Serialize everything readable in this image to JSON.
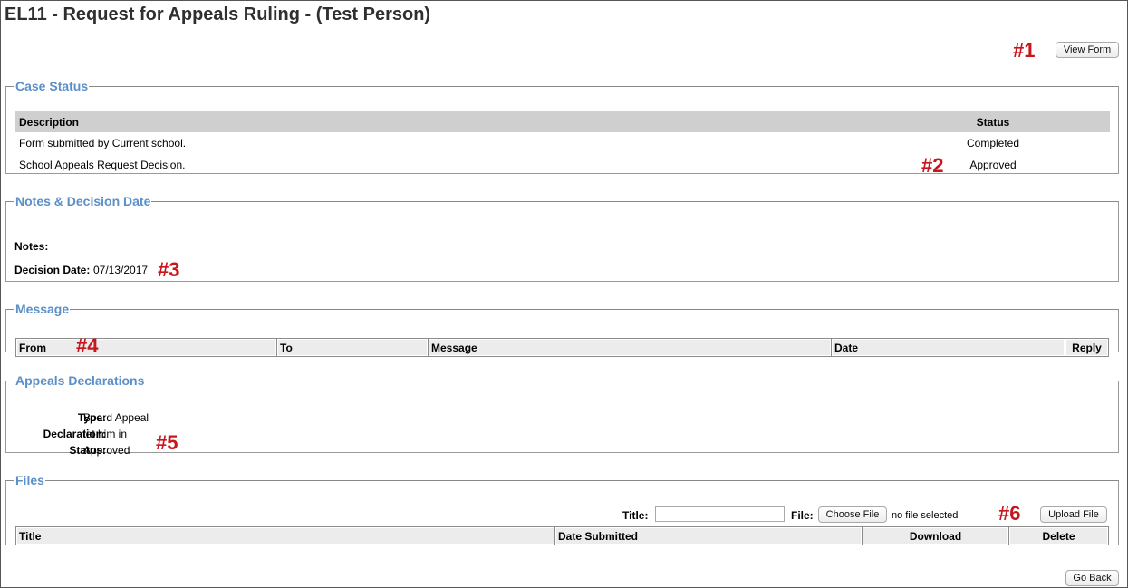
{
  "page": {
    "title": "EL11 - Request for Appeals Ruling - (Test Person)"
  },
  "top_actions": {
    "view_form_label": "View Form",
    "marker": "#1"
  },
  "case_status": {
    "legend": "Case Status",
    "columns": [
      "Description",
      "Status"
    ],
    "rows": [
      {
        "description": "Form submitted by Current school.",
        "status": "Completed"
      },
      {
        "description": "School Appeals Request Decision.",
        "status": "Approved"
      }
    ],
    "marker": "#2"
  },
  "notes": {
    "legend": "Notes & Decision Date",
    "notes_label": "Notes:",
    "notes_value": "",
    "decision_label": "Decision Date:",
    "decision_value": "07/13/2017",
    "marker": "#3"
  },
  "message": {
    "legend": "Message",
    "columns": [
      "From",
      "To",
      "Message",
      "Date",
      "Reply"
    ],
    "marker": "#4"
  },
  "declarations": {
    "legend": "Appeals Declarations",
    "type_label": "Type:",
    "type_value": "Board Appeal",
    "declaration_label": "Declaration:",
    "declaration_value": "let him in",
    "status_label": "Status:",
    "status_value": "Approved",
    "marker": "#5"
  },
  "files": {
    "legend": "Files",
    "title_label": "Title:",
    "title_value": "",
    "file_label": "File:",
    "choose_file_label": "Choose File",
    "file_status": "no file selected",
    "upload_label": "Upload File",
    "columns": [
      "Title",
      "Date Submitted",
      "Download",
      "Delete"
    ],
    "marker": "#6"
  },
  "footer": {
    "go_back_label": "Go Back"
  }
}
